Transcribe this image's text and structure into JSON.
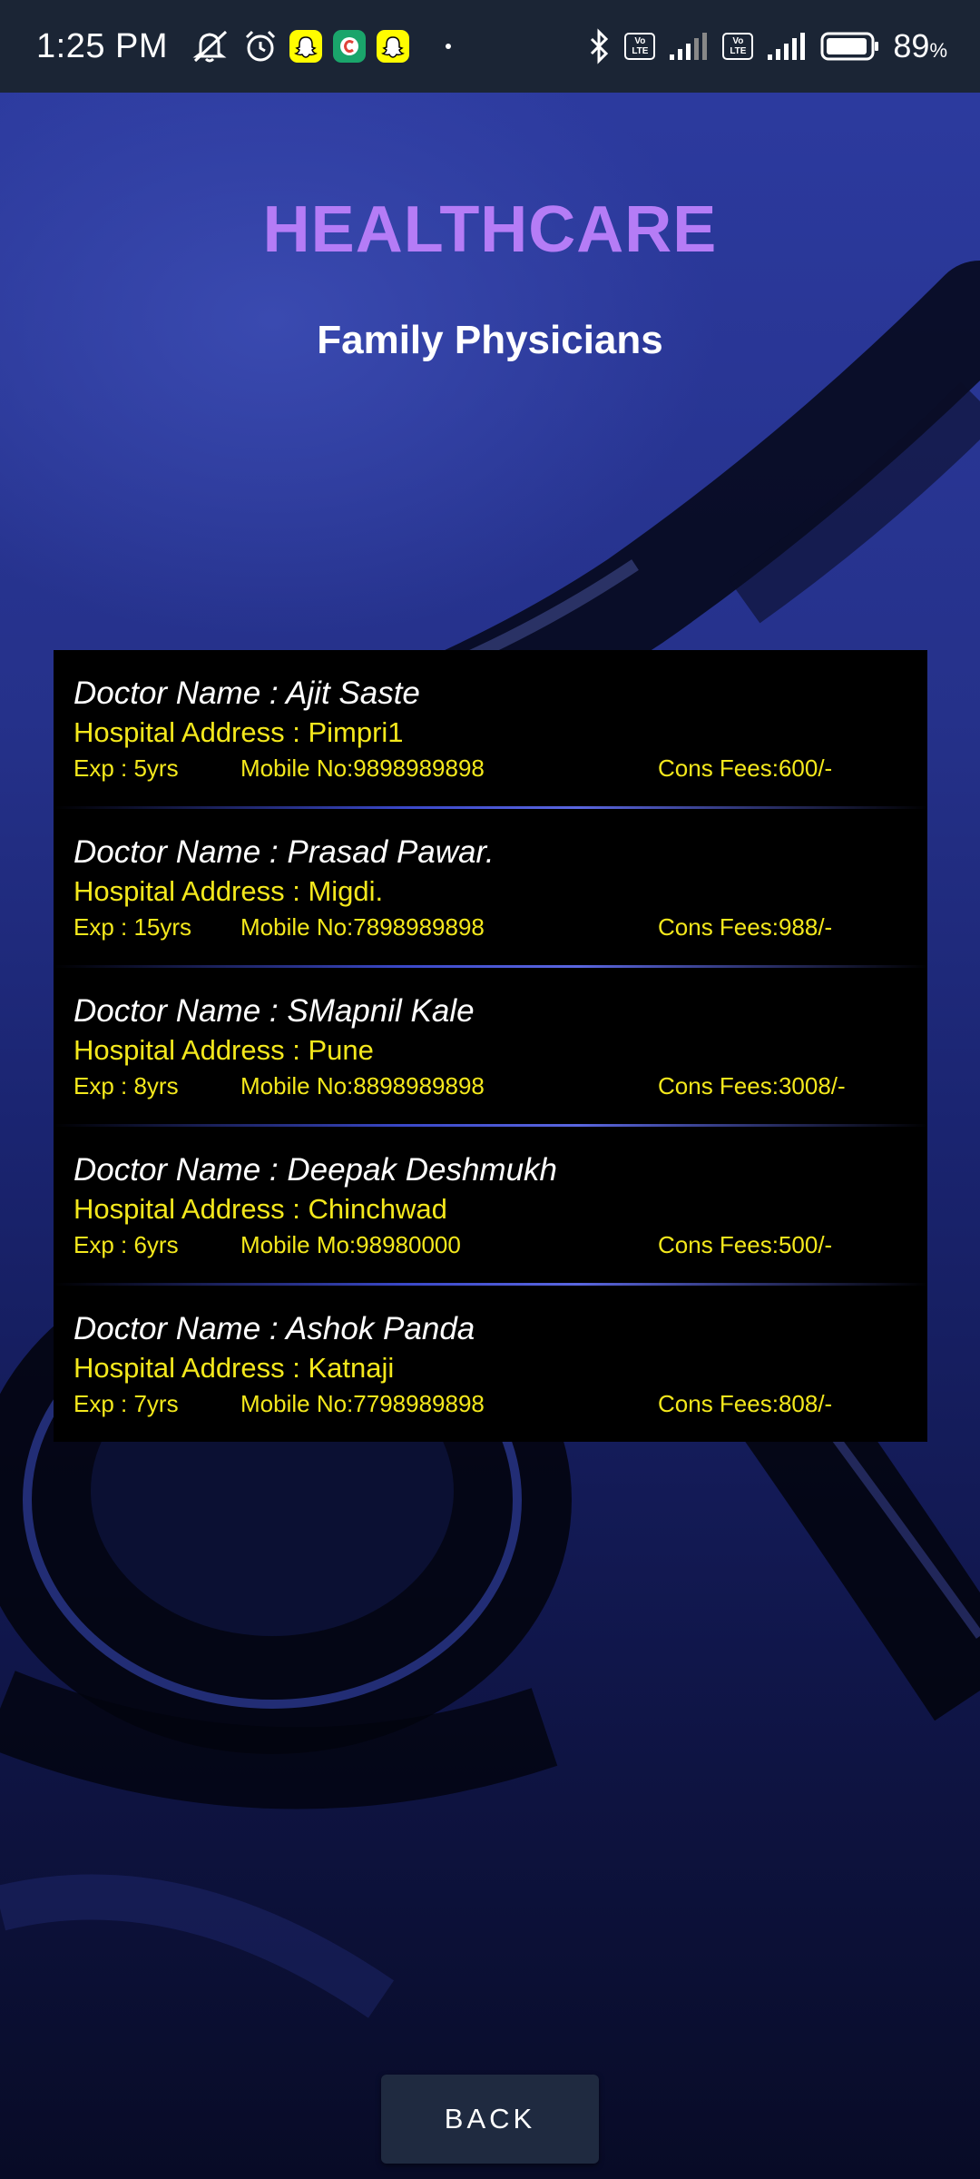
{
  "status_bar": {
    "time": "1:25 PM",
    "battery": "89",
    "battery_unit": "%",
    "icons": [
      "mute-icon",
      "alarm-icon",
      "snapchat-icon",
      "app-c-icon",
      "snapchat-icon",
      "bluetooth-icon",
      "volte-icon",
      "signal-icon",
      "volte-icon",
      "signal-icon",
      "battery-icon"
    ]
  },
  "header": {
    "app_title": "HEALTHCARE",
    "page_title": "Family Physicians"
  },
  "doctors": [
    {
      "name": "Doctor Name : Ajit Saste",
      "address": "Hospital Address : Pimpri1",
      "exp": "Exp : 5yrs",
      "mobile": "Mobile No:9898989898",
      "fees": "Cons Fees:600/-"
    },
    {
      "name": "Doctor Name : Prasad Pawar.",
      "address": "Hospital Address : Migdi.",
      "exp": "Exp : 15yrs",
      "mobile": "Mobile No:7898989898",
      "fees": "Cons Fees:988/-"
    },
    {
      "name": "Doctor Name : SMapnil Kale",
      "address": "Hospital Address : Pune",
      "exp": "Exp : 8yrs",
      "mobile": "Mobile No:8898989898",
      "fees": "Cons Fees:3008/-"
    },
    {
      "name": "Doctor Name : Deepak Deshmukh",
      "address": "Hospital Address : Chinchwad",
      "exp": "Exp : 6yrs",
      "mobile": "Mobile Mo:98980000",
      "fees": "Cons Fees:500/-"
    },
    {
      "name": "Doctor Name : Ashok Panda",
      "address": "Hospital Address : Katnaji",
      "exp": "Exp : 7yrs",
      "mobile": "Mobile No:7798989898",
      "fees": "Cons Fees:808/-"
    }
  ],
  "footer": {
    "back_label": "BACK"
  },
  "colors": {
    "title": "#b57cf6",
    "accent_text": "#f4e81c",
    "list_bg": "#000000",
    "button_bg": "#1f2a40"
  }
}
